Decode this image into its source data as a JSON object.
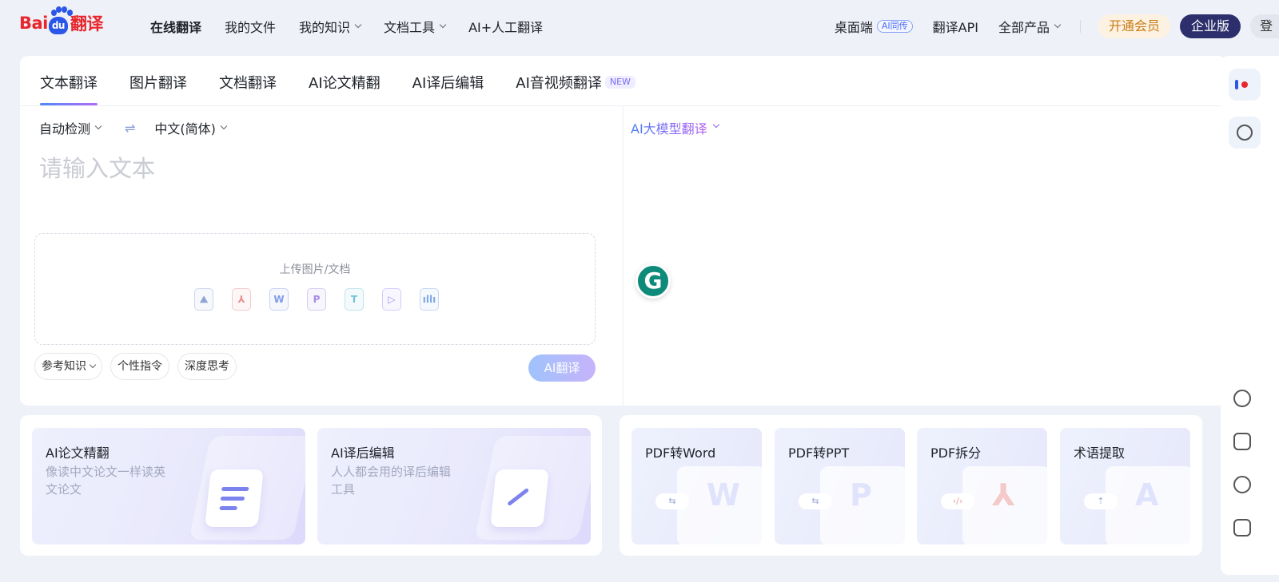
{
  "logo": {
    "part1": "Bai",
    "part2": "du",
    "part3": "翻译"
  },
  "nav": {
    "items": [
      {
        "label": "在线翻译",
        "dropdown": false,
        "active": true
      },
      {
        "label": "我的文件",
        "dropdown": false,
        "active": false
      },
      {
        "label": "我的知识",
        "dropdown": true,
        "active": false
      },
      {
        "label": "文档工具",
        "dropdown": true,
        "active": false
      },
      {
        "label": "AI+人工翻译",
        "dropdown": false,
        "active": false
      }
    ]
  },
  "right_nav": {
    "desktop": "桌面端",
    "desktop_badge": "AI同传",
    "api": "翻译API",
    "products": "全部产品",
    "vip": "开通会员",
    "enterprise": "企业版",
    "login": "登"
  },
  "tabs": [
    {
      "label": "文本翻译",
      "active": true
    },
    {
      "label": "图片翻译",
      "active": false
    },
    {
      "label": "文档翻译",
      "active": false
    },
    {
      "label": "AI论文精翻",
      "active": false
    },
    {
      "label": "AI译后编辑",
      "active": false
    },
    {
      "label": "AI音视频翻译",
      "active": false,
      "badge": "NEW"
    }
  ],
  "translator": {
    "source_lang": "自动检测",
    "swap_icon": "⇌",
    "target_lang": "中文(简体)",
    "placeholder": "请输入文本",
    "upload_label": "上传图片/文档",
    "file_types": [
      {
        "name": "image-file-icon",
        "glyph": "⛰",
        "color": "#8fa3d9"
      },
      {
        "name": "pdf-file-icon",
        "glyph": "⅄",
        "color": "#e88b8b"
      },
      {
        "name": "word-file-icon",
        "glyph": "W",
        "color": "#7f9be6"
      },
      {
        "name": "ppt-file-icon",
        "glyph": "P",
        "color": "#a88be6"
      },
      {
        "name": "txt-file-icon",
        "glyph": "T",
        "color": "#6fc3d8"
      },
      {
        "name": "video-file-icon",
        "glyph": "▷",
        "color": "#a58ef0"
      },
      {
        "name": "audio-file-icon",
        "glyph": "ıllı",
        "color": "#7fa7e6"
      }
    ],
    "chips": {
      "reference": "参考知识",
      "instruction": "个性指令",
      "deep_think": "深度思考"
    },
    "translate_button": "AI翻译",
    "model_select": "AI大模型翻译"
  },
  "features": [
    {
      "title": "AI论文精翻",
      "desc": "像读中文论文一样读英文论文"
    },
    {
      "title": "AI译后编辑",
      "desc": "人人都会用的译后编辑工具"
    }
  ],
  "tools": [
    {
      "title": "PDF转Word",
      "pill": "⇆",
      "glyph": "W"
    },
    {
      "title": "PDF转PPT",
      "pill": "⇆",
      "glyph": "P"
    },
    {
      "title": "PDF拆分",
      "pill": "‹/›",
      "glyph": "⅄"
    },
    {
      "title": "术语提取",
      "pill": "⇡",
      "glyph": "A"
    }
  ],
  "colors": {
    "accent": "#4a6cf7",
    "enterprise": "#2c2f6b",
    "vip_text": "#c77b16",
    "grammarly": "#0e8a7a"
  }
}
